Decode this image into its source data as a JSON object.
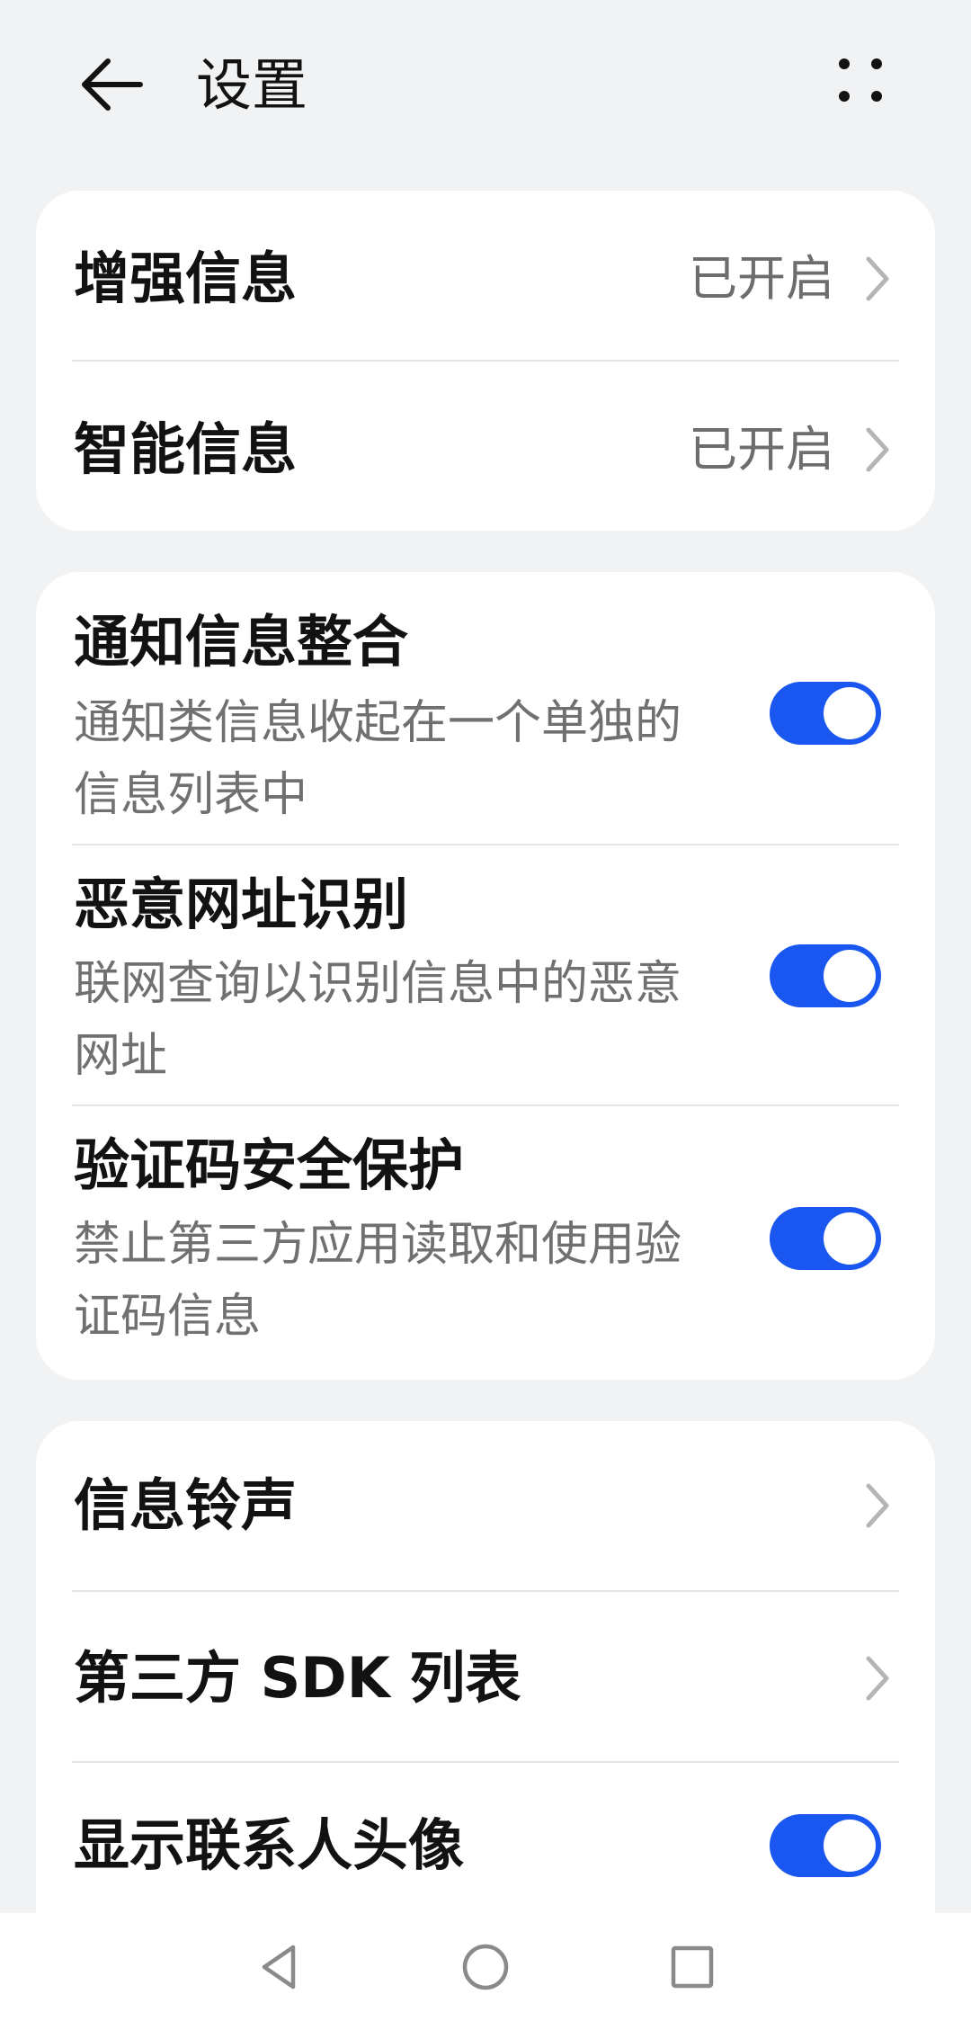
{
  "header": {
    "title": "设置",
    "back_icon": "back-arrow-icon",
    "more_icon": "more-dots-icon"
  },
  "group1": {
    "items": [
      {
        "title": "增强信息",
        "value": "已开启"
      },
      {
        "title": "智能信息",
        "value": "已开启"
      }
    ]
  },
  "group2": {
    "items": [
      {
        "title": "通知信息整合",
        "subtitle": "通知类信息收起在一个单独的信息列表中",
        "enabled": true
      },
      {
        "title": "恶意网址识别",
        "subtitle": "联网查询以识别信息中的恶意网址",
        "enabled": true
      },
      {
        "title": "验证码安全保护",
        "subtitle": "禁止第三方应用读取和使用验证码信息",
        "enabled": true
      }
    ]
  },
  "group3": {
    "items": [
      {
        "title": "信息铃声"
      },
      {
        "title": "第三方 SDK 列表"
      },
      {
        "title": "显示联系人头像",
        "enabled": true
      }
    ]
  },
  "colors": {
    "accent": "#1a56f0",
    "background": "#f1f2f4",
    "card": "#ffffff"
  }
}
